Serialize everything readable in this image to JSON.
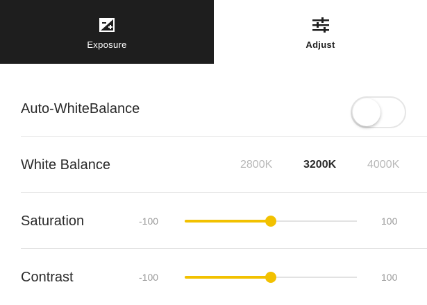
{
  "tabs": [
    {
      "label": "Exposure",
      "icon": "exposure-icon",
      "active": true
    },
    {
      "label": "Adjust",
      "icon": "adjust-sliders-icon",
      "active": false
    }
  ],
  "auto_white_balance": {
    "label": "Auto-WhiteBalance",
    "enabled": false
  },
  "white_balance": {
    "label": "White Balance",
    "options": [
      "2800K",
      "3200K",
      "4000K"
    ],
    "selected": "3200K"
  },
  "saturation": {
    "label": "Saturation",
    "min_label": "-100",
    "max_label": "100",
    "min": -100,
    "max": 100,
    "value": 0
  },
  "contrast": {
    "label": "Contrast",
    "min_label": "-100",
    "max_label": "100",
    "min": -100,
    "max": 100,
    "value": 0
  },
  "colors": {
    "accent": "#f2c100",
    "tab_active_bg": "#1e1e1e",
    "divider": "#e4e4e4"
  }
}
